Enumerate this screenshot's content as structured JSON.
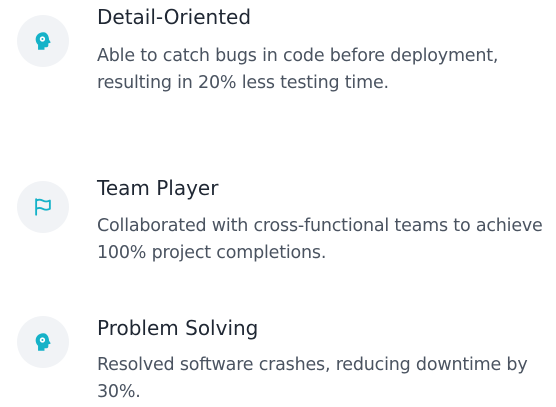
{
  "colors": {
    "accent": "#15b2c8",
    "icon_bg": "#f1f3f6",
    "title": "#1f2733",
    "body_text": "#4a5360"
  },
  "skills": [
    {
      "icon": "head-icon",
      "title": "Detail-Oriented",
      "description": "Able to catch bugs in code before deployment, resulting in 20% less testing time."
    },
    {
      "icon": "flag-icon",
      "title": "Team Player",
      "description": "Collaborated with cross-functional teams to achieve 100% project completions."
    },
    {
      "icon": "head-icon",
      "title": "Problem Solving",
      "description": "Resolved software crashes, reducing downtime by 30%."
    }
  ]
}
